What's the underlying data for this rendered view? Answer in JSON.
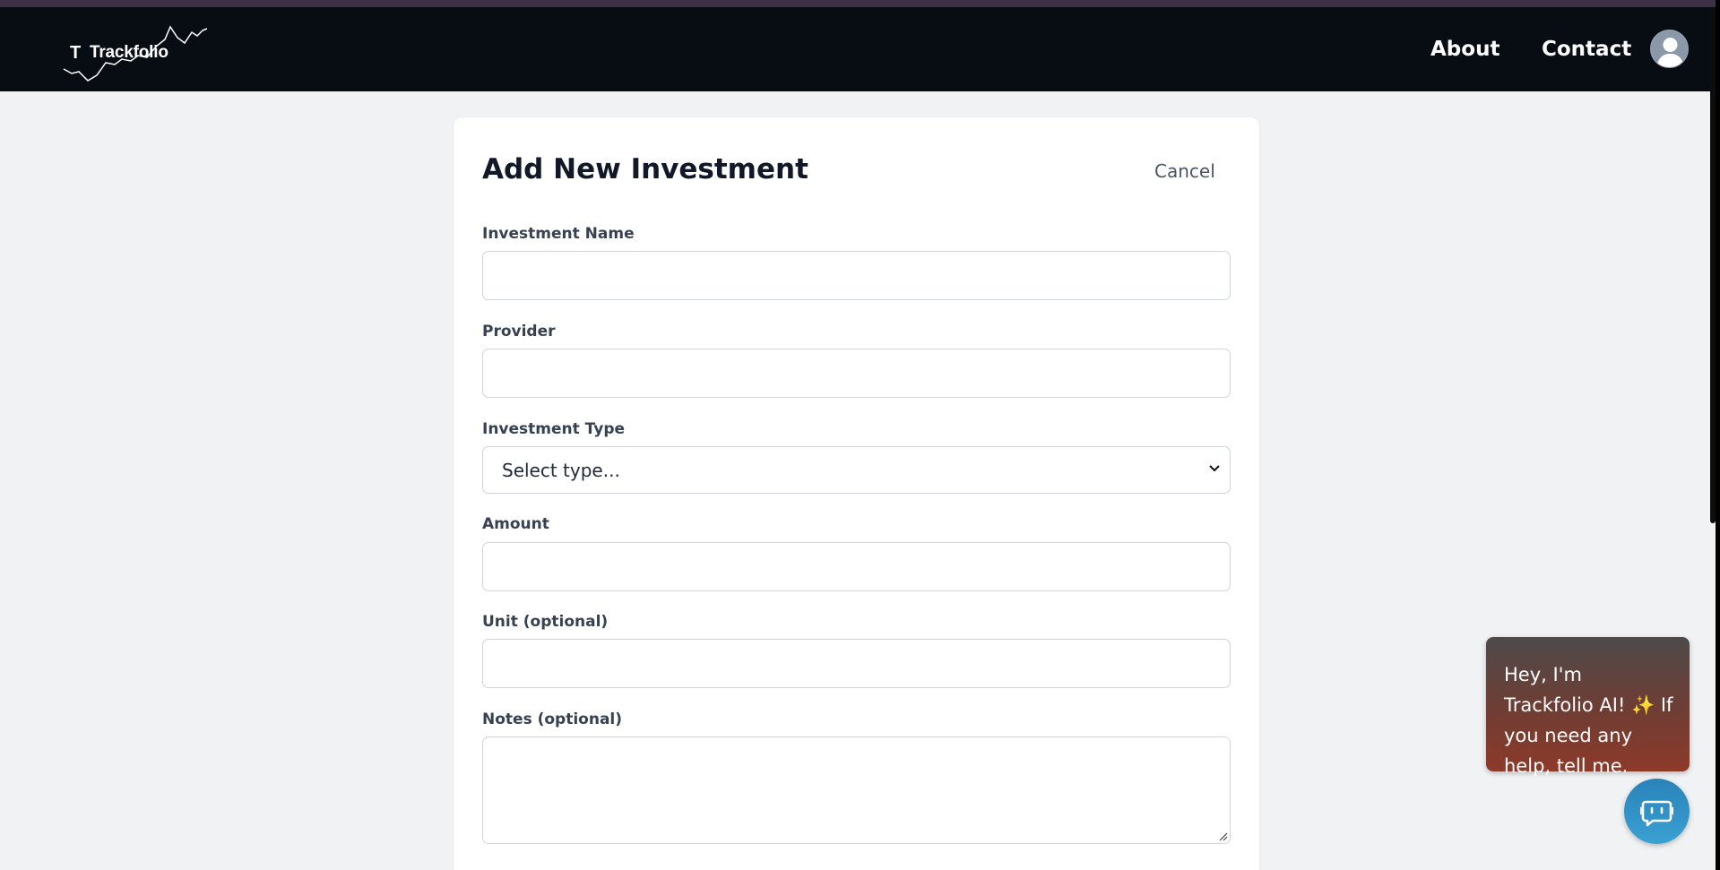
{
  "brand": {
    "name": "Trackfolio",
    "mark": "T"
  },
  "nav": {
    "about": "About",
    "contact": "Contact"
  },
  "form": {
    "title": "Add New Investment",
    "cancel": "Cancel",
    "fields": {
      "investment_name": {
        "label": "Investment Name",
        "value": ""
      },
      "provider": {
        "label": "Provider",
        "value": ""
      },
      "investment_type": {
        "label": "Investment Type",
        "selected": "Select type..."
      },
      "amount": {
        "label": "Amount",
        "value": ""
      },
      "unit": {
        "label": "Unit (optional)",
        "value": ""
      },
      "notes": {
        "label": "Notes (optional)",
        "value": ""
      }
    }
  },
  "assistant": {
    "greeting": "Hey, I'm Trackfolio AI! ✨ If you need any help, tell me."
  },
  "icons": {
    "avatar": "user-avatar-icon",
    "chevron": "chevron-down-icon",
    "chat": "robot-chat-icon"
  },
  "colors": {
    "navbar": "#080d14",
    "background": "#f1f2f4",
    "card": "#ffffff",
    "chat_button": "#3aa0d2",
    "chat_bubble": "#6f3d33"
  }
}
